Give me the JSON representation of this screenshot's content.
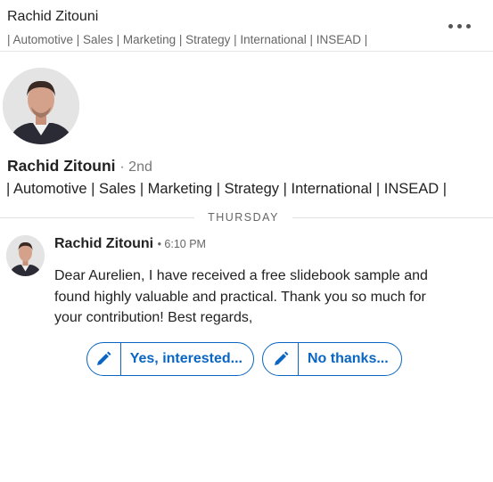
{
  "header": {
    "name": "Rachid Zitouni",
    "headline": "| Automotive | Sales | Marketing | Strategy | International | INSEAD |",
    "more_icon": "more-horizontal-icon"
  },
  "profile": {
    "name": "Rachid Zitouni",
    "degree": "· 2nd",
    "headline": "| Automotive | Sales | Marketing | Strategy | International | INSEAD |"
  },
  "divider": {
    "label": "THURSDAY"
  },
  "message": {
    "sender": "Rachid Zitouni",
    "time": "• 6:10 PM",
    "body": "Dear Aurelien, I have received a free slidebook sample and found highly valuable and practical. Thank you so much for your contribution! Best regards,"
  },
  "quick_replies": [
    {
      "label": "Yes, interested...",
      "icon": "pencil-icon"
    },
    {
      "label": "No thanks...",
      "icon": "pencil-icon"
    }
  ],
  "colors": {
    "accent": "#0a66c2",
    "muted": "#666666"
  }
}
